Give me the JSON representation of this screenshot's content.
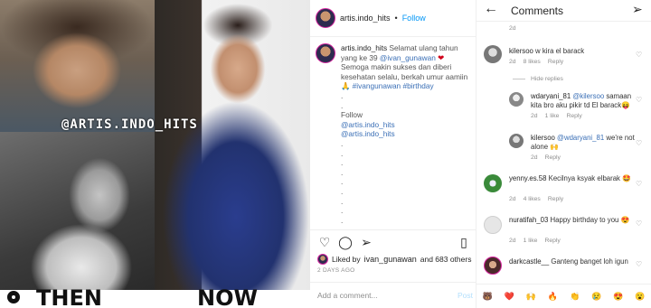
{
  "photo": {
    "watermark": "@ARTIS.INDO_HITS",
    "then_label": "THEN",
    "now_label": "NOW"
  },
  "post": {
    "username": "artis.indo_hits",
    "separator": "•",
    "follow_label": "Follow",
    "caption_username": "artis.indo_hits",
    "caption_lead": "Selamat ulang tahun yang ke 39 ",
    "caption_mention": "@ivan_gunawan",
    "caption_heart": "❤",
    "caption_body": "Semoga makin sukses dan diberi kesehatan selalu, berkah umur aamiin",
    "caption_emoji": "🙏",
    "caption_tags": "#ivangunawan #birthday",
    "caption_follow": "Follow",
    "caption_follow_1": "@artis.indo_hits",
    "caption_follow_2": "@artis.indo_hits",
    "likes_prefix": "Liked by",
    "likes_user": "ivan_gunawan",
    "likes_suffix": "and 683 others",
    "date": "2 DAYS AGO",
    "comment_placeholder": "Add a comment...",
    "post_button": "Post"
  },
  "comments": {
    "title": "Comments",
    "hide_replies": "Hide replies",
    "items": [
      {
        "username": "",
        "text": "",
        "time": "2d",
        "likes": "",
        "reply": ""
      },
      {
        "username": "kilersoo",
        "text": "w kira el barack",
        "time": "2d",
        "likes": "8 likes",
        "reply": "Reply"
      },
      {
        "username": "wdaryani_81",
        "mention": "@kilersoo",
        "text": "samaan kita bro aku pikir td El barack😝",
        "time": "2d",
        "likes": "1 like",
        "reply": "Reply"
      },
      {
        "username": "kilersoo",
        "mention": "@wdaryani_81",
        "text": "we're not alone 🙌",
        "time": "2d",
        "likes": "",
        "reply": "Reply"
      },
      {
        "username": "yenny.es.58",
        "text": "Kecilnya  ksyak  elbarak 🤩",
        "time": "2d",
        "likes": "4 likes",
        "reply": "Reply"
      },
      {
        "username": "nuratifah_03",
        "text": "Happy birthday to you 😍",
        "time": "2d",
        "likes": "1 like",
        "reply": "Reply"
      },
      {
        "username": "darkcastle__",
        "text": "Ganteng banget loh igun",
        "time": "",
        "likes": "",
        "reply": ""
      }
    ],
    "emoji_bar": [
      "🐻",
      "❤️",
      "🙌",
      "🔥",
      "👏",
      "😢",
      "😍",
      "😮"
    ]
  },
  "colors": {
    "link_blue": "#0095f6",
    "meta_gray": "#8e8e8e",
    "heart_red": "#d0021b",
    "story_ring": "#d6249f"
  }
}
